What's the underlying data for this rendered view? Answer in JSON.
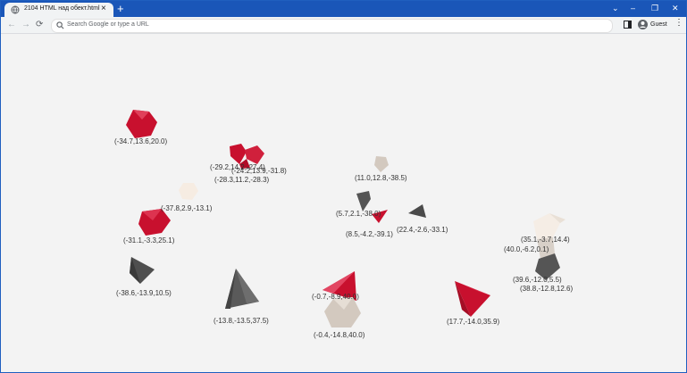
{
  "browser": {
    "tab_title": "2104 HTML над обект.html",
    "tab_close": "×",
    "new_tab": "+",
    "address_placeholder": "Search Google or type a URL",
    "profile": "Guest",
    "controls": {
      "chevron": "⌄",
      "minimize": "–",
      "restore": "❐",
      "close": "✕"
    },
    "nav": {
      "back": "←",
      "forward": "→",
      "reload": "⟳",
      "menu": "⋮"
    }
  },
  "scene": {
    "colors": {
      "red": "#c8102e",
      "gray": "#555555",
      "beige": "#d8d0c8",
      "cream": "#f5ede5",
      "background": "#f3f3f3"
    },
    "objects": [
      {
        "label": "(-34.7,13.6,20.0)",
        "color": "red",
        "shape": "hexagon"
      },
      {
        "label": "(-29.2,14.2,-27.4)",
        "color": "red",
        "shape": "cluster"
      },
      {
        "label": "(-24.2,13.9,-31.8)",
        "color": "red",
        "shape": "cluster"
      },
      {
        "label": "(-28.3,11.2,-28.3)",
        "color": "red",
        "shape": "cluster"
      },
      {
        "label": "(11.0,12.8,-38.5)",
        "color": "beige",
        "shape": "small"
      },
      {
        "label": "(-37.8,2.9,-13.1)",
        "color": "cream",
        "shape": "small"
      },
      {
        "label": "(5.7,2.1,-38.0)",
        "color": "gray",
        "shape": "small"
      },
      {
        "label": "(8.5,-4.2,-39.1)",
        "color": "red",
        "shape": "tiny"
      },
      {
        "label": "(22.4,-2.6,-33.1)",
        "color": "gray",
        "shape": "tiny"
      },
      {
        "label": "(-31.1,-3.3,25.1)",
        "color": "red",
        "shape": "pentagon"
      },
      {
        "label": "(35.1,-3.7,14.4)",
        "color": "cream",
        "shape": "cluster"
      },
      {
        "label": "(40.0,-6.2,0.1)",
        "color": "cream",
        "shape": "cluster"
      },
      {
        "label": "(39.6,-12.0,5.5)",
        "color": "gray",
        "shape": "cluster"
      },
      {
        "label": "(38.8,-12.8,12.6)",
        "color": "gray",
        "shape": "cluster"
      },
      {
        "label": "(-38.6,-13.9,10.5)",
        "color": "gray",
        "shape": "pyramid"
      },
      {
        "label": "(-13.8,-13.5,37.5)",
        "color": "gray",
        "shape": "tetra"
      },
      {
        "label": "(-0.7,-8.9,40.0)",
        "color": "red",
        "shape": "pyramid"
      },
      {
        "label": "(-0.4,-14.8,40.0)",
        "color": "beige",
        "shape": "rock"
      },
      {
        "label": "(17.7,-14.0,35.9)",
        "color": "red",
        "shape": "pyramid"
      }
    ]
  }
}
